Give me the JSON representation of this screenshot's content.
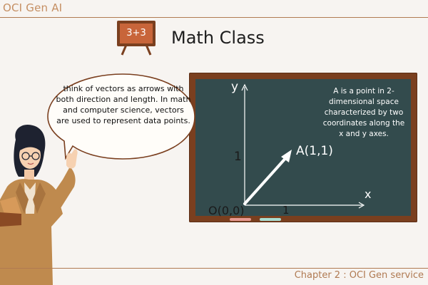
{
  "header": {
    "course_title": "OCI Gen AI"
  },
  "heading": {
    "title": "Math Class",
    "board_icon_text": "3+3"
  },
  "speech_bubble": {
    "text": "think of vectors as arrows with both direction and length. In math and computer science, vectors are used to represent data points."
  },
  "chalkboard": {
    "note": "A is a point in 2-dimensional space characterized by two coordinates along the x and y axes.",
    "y_axis_label": "y",
    "x_axis_label": "x",
    "y_tick": "1",
    "x_tick": "1",
    "origin_label": "O(0,0)",
    "point_label": "A(1,1)"
  },
  "footer": {
    "chapter": "Chapter 2 : OCI Gen service"
  },
  "colors": {
    "accent": "#b07a52",
    "board_green": "#334b4d",
    "board_frame": "#7a3f1f",
    "teacher_coat": "#bf8a4e"
  },
  "icons": [
    "chalkboard-icon",
    "teacher-illustration",
    "speech-bubble",
    "vector-arrow"
  ]
}
